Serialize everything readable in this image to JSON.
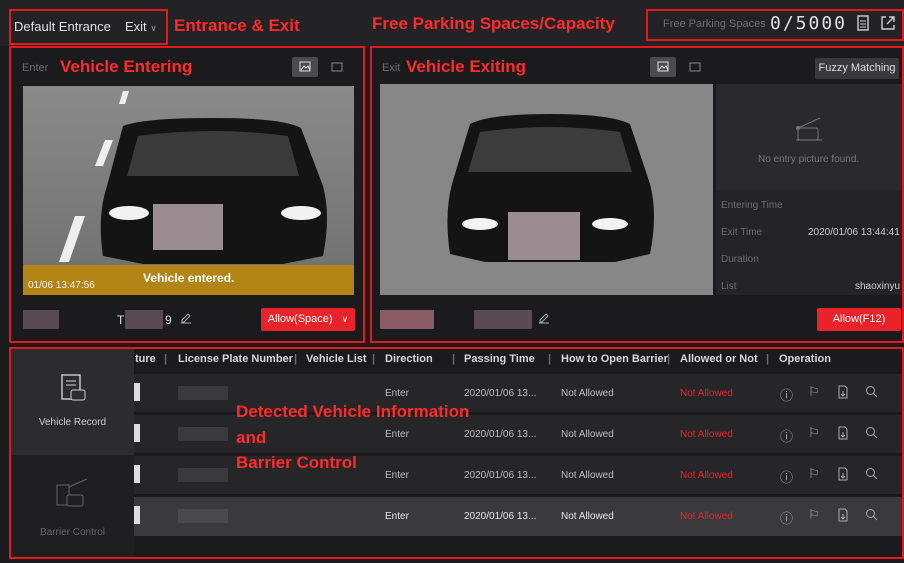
{
  "header": {
    "entrance_select": "Default Entrance",
    "exit_select": "Exit",
    "anno_entrance_exit": "Entrance & Exit",
    "anno_free_parking": "Free Parking Spaces/Capacity",
    "free_parking_label": "Free Parking Spaces",
    "free_parking_value": "0/5000"
  },
  "enter_panel": {
    "label": "Enter",
    "anno": "Vehicle Entering",
    "timestamp": "01/06 13:47:56",
    "status": "Vehicle entered.",
    "plate_partial_a": "T",
    "plate_partial_b": "9",
    "allow_button": "Allow(Space)"
  },
  "exit_panel": {
    "label": "Exit",
    "anno": "Vehicle Exiting",
    "fuzzy_button": "Fuzzy Matching",
    "no_entry_text": "No entry picture found.",
    "entering_time_label": "Entering Time",
    "exit_time_label": "Exit Time",
    "exit_time_value": "2020/01/06 13:44:41",
    "duration_label": "Duration",
    "list_label": "List",
    "list_value": "shaoxinyu",
    "allow_button": "Allow(F12)"
  },
  "sidebar": {
    "vehicle_record": "Vehicle Record",
    "barrier_control": "Barrier Control"
  },
  "table": {
    "headers": [
      "ture",
      "License Plate Number",
      "Vehicle List",
      "Direction",
      "Passing Time",
      "How to Open Barrier",
      "Allowed or Not",
      "Operation"
    ],
    "rows": [
      {
        "direction": "Enter",
        "time": "2020/01/06 13...",
        "how": "Not Allowed",
        "allowed": "Not Allowed"
      },
      {
        "direction": "Enter",
        "time": "2020/01/06 13...",
        "how": "Not Allowed",
        "allowed": "Not Allowed"
      },
      {
        "direction": "Enter",
        "time": "2020/01/06 13...",
        "how": "Not Allowed",
        "allowed": "Not Allowed"
      },
      {
        "direction": "Enter",
        "time": "2020/01/06 13...",
        "how": "Not Allowed",
        "allowed": "Not Allowed"
      }
    ],
    "anno_line1": "Detected Vehicle Information",
    "anno_line2": "and",
    "anno_line3": "Barrier Control"
  },
  "colors": {
    "accent_red": "#e3191e",
    "not_allowed": "#e8232a"
  }
}
